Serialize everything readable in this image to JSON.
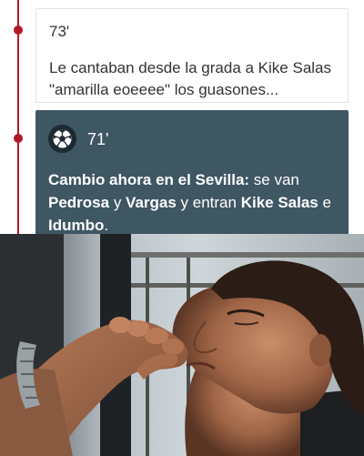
{
  "entries": [
    {
      "minute": "73'",
      "text": "Le cantaban desde la grada a Kike Salas \"amarilla eoeeee\" los guasones..."
    },
    {
      "minute": "71'",
      "icon": "soccer-ball-icon",
      "lead": "Cambio ahora en el Sevilla:",
      "t1": " se van ",
      "p1": "Pedrosa",
      "t2": " y ",
      "p2": "Vargas",
      "t3": " y entran ",
      "p3": "Kike Salas",
      "t4": " e ",
      "p4": "Idumbo",
      "t5": "."
    }
  ],
  "colors": {
    "timeline_accent": "#b3182a",
    "event_card_bg": "#3f5663"
  },
  "photo": {
    "subject": "man-kissing-fingertips-photo"
  }
}
